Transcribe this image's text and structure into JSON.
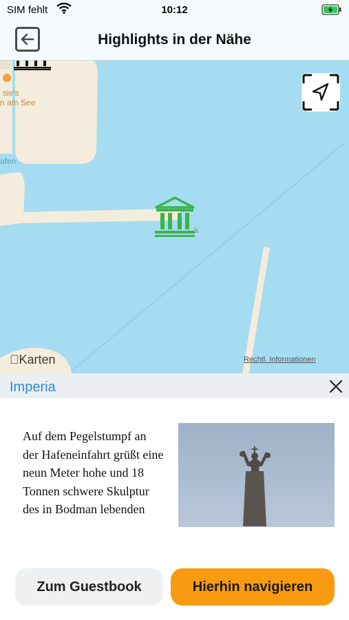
{
  "status_bar": {
    "carrier": "SIM fehlt",
    "time": "10:12",
    "wifi_icon": "wifi-icon",
    "battery_icon": "battery-charging-icon"
  },
  "header": {
    "title": "Highlights in der Nähe",
    "back_icon": "back-arrow-icon"
  },
  "map": {
    "labels": {
      "poi_name_line1": "sie's",
      "poi_name_line2": "n am See",
      "harbor": "afen",
      "marker_label": "a"
    },
    "attribution": "Karten",
    "legal_link": "Rechtl. Informationen",
    "locate_icon": "location-arrow-icon",
    "marker_icon": "museum-icon",
    "colors": {
      "water": "#a6dcf1",
      "land": "#f4ecdc",
      "marker": "#3bb54a"
    }
  },
  "detail": {
    "title": "Imperia",
    "description": "Auf dem Pegelstumpf an der Hafeneinfahrt grüßt eine neun Meter hohe und 18 Tonnen schwere Skulptur des in Bodman lebenden",
    "close_icon": "close-icon"
  },
  "actions": {
    "guestbook_label": "Zum Guestbook",
    "navigate_label": "Hierhin navigieren",
    "navigate_color": "#f89b10"
  }
}
